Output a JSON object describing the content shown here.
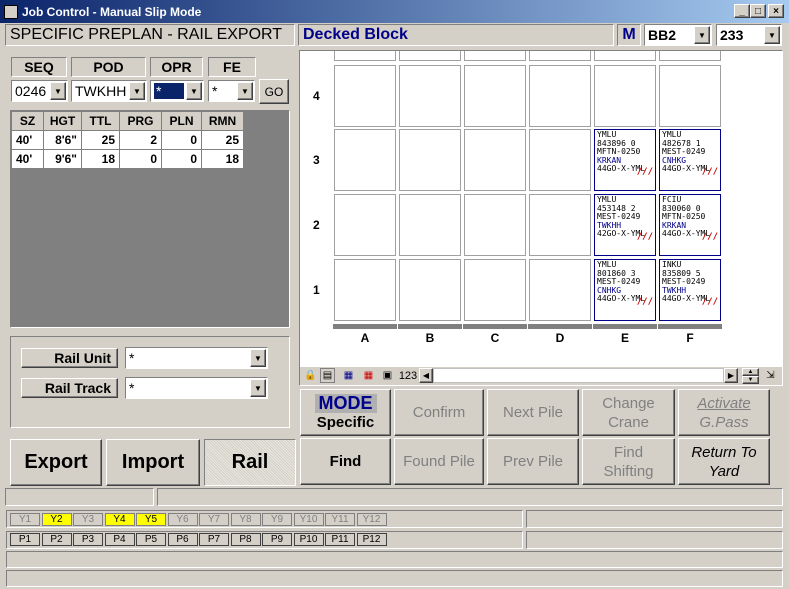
{
  "window": {
    "title": "Job Control - Manual Slip Mode",
    "controls": [
      "_",
      "□",
      "×"
    ]
  },
  "header": {
    "left_title": "SPECIFIC PREPLAN - RAIL EXPORT",
    "block_title": "Decked Block",
    "mode_letter": "M",
    "block_select": "BB2",
    "bay_select": "233"
  },
  "filters": {
    "labels": {
      "seq": "SEQ",
      "pod": "POD",
      "opr": "OPR",
      "fe": "FE"
    },
    "values": {
      "seq": "0246",
      "pod": "TWKHH",
      "opr": "*",
      "fe": "*"
    },
    "go": "GO"
  },
  "summary_table": {
    "headers": [
      "SZ",
      "HGT",
      "TTL",
      "PRG",
      "PLN",
      "RMN"
    ],
    "rows": [
      [
        "40'",
        "8'6\"",
        "25",
        "2",
        "0",
        "25"
      ],
      [
        "40'",
        "9'6\"",
        "18",
        "0",
        "0",
        "18"
      ]
    ]
  },
  "rail": {
    "unit_label": "Rail Unit",
    "unit_value": "*",
    "track_label": "Rail Track",
    "track_value": "*"
  },
  "bottom_tabs": {
    "export": "Export",
    "import": "Import",
    "rail": "Rail"
  },
  "commands": {
    "mode_title": "MODE",
    "mode_value": "Specific",
    "confirm": "Confirm",
    "next_pile": "Next Pile",
    "change_crane_1": "Change",
    "change_crane_2": "Crane",
    "activate_1": "Activate",
    "activate_2": "G.Pass",
    "find": "Find",
    "found_pile": "Found Pile",
    "prev_pile": "Prev Pile",
    "find_shifting_1": "Find",
    "find_shifting_2": "Shifting",
    "return_1": "Return To",
    "return_2": "Yard"
  },
  "yard": {
    "columns": [
      "A",
      "B",
      "C",
      "D",
      "E",
      "F"
    ],
    "rows": [
      "4",
      "3",
      "2",
      "1"
    ],
    "containers": [
      {
        "col": "E",
        "row": "3",
        "l1": "YMLU",
        "l2": " 843896 0",
        "l3": "MFTN-0250",
        "l4": "KRKAN",
        "l5": "44GO-X-YML"
      },
      {
        "col": "F",
        "row": "3",
        "l1": "YMLU",
        "l2": " 482678 1",
        "l3": "MEST-0249",
        "l4": "CNHKG",
        "l5": "44GO-X-YML"
      },
      {
        "col": "E",
        "row": "2",
        "l1": "YMLU",
        "l2": " 453148 2",
        "l3": "MEST-0249",
        "l4": "TWKHH",
        "l5": "42GO-X-YML"
      },
      {
        "col": "F",
        "row": "2",
        "l1": "FCIU",
        "l2": " 830060 0",
        "l3": "MFTN-0250",
        "l4": "KRKAN",
        "l5": "44GO-X-YML"
      },
      {
        "col": "E",
        "row": "1",
        "l1": "YMLU",
        "l2": " 801860 3",
        "l3": "MEST-0249",
        "l4": "CNHKG",
        "l5": "44GO-X-YML"
      },
      {
        "col": "F",
        "row": "1",
        "l1": "INKU",
        "l2": " 835809 5",
        "l3": "MEST-0249",
        "l4": "TWKHH",
        "l5": "44GO-X-YML"
      }
    ],
    "mark": "///",
    "toolbar_label": "123"
  },
  "bays": {
    "y": [
      "Y1",
      "Y2",
      "Y3",
      "Y4",
      "Y5",
      "Y6",
      "Y7",
      "Y8",
      "Y9",
      "Y10",
      "Y11",
      "Y12"
    ],
    "y_highlight": [
      "Y2",
      "Y4",
      "Y5"
    ],
    "p": [
      "P1",
      "P2",
      "P3",
      "P4",
      "P5",
      "P6",
      "P7",
      "P8",
      "P9",
      "P10",
      "P11",
      "P12"
    ]
  },
  "colors": {
    "title_start": "#0a246a",
    "title_end": "#a6caf0",
    "accent_blue": "#00008b",
    "highlight_yellow": "#ffff00",
    "mark_red": "#cc0000"
  }
}
